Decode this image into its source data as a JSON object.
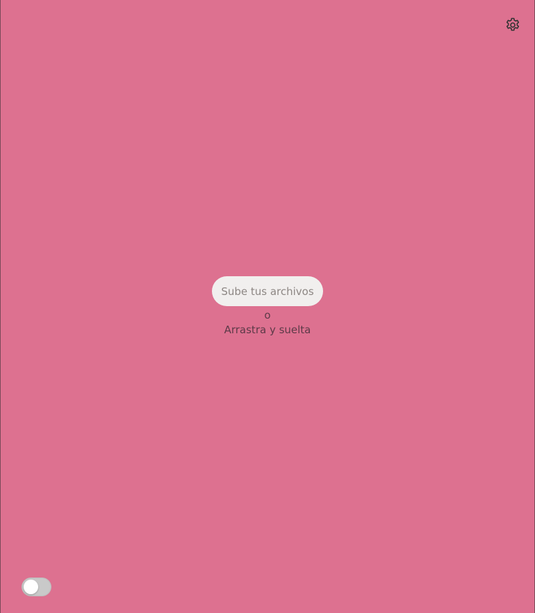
{
  "colors": {
    "background": "#dd7190",
    "button_bg": "#f1efee",
    "button_text": "#8d8784",
    "text": "#5d3a48",
    "toggle_track": "#c9c9c9"
  },
  "header": {
    "settings_icon": "gear-icon"
  },
  "dropzone": {
    "upload_label": "Sube tus archivos",
    "or_label": "o",
    "drag_label": "Arrastra y suelta"
  },
  "footer": {
    "toggle_on": false
  }
}
